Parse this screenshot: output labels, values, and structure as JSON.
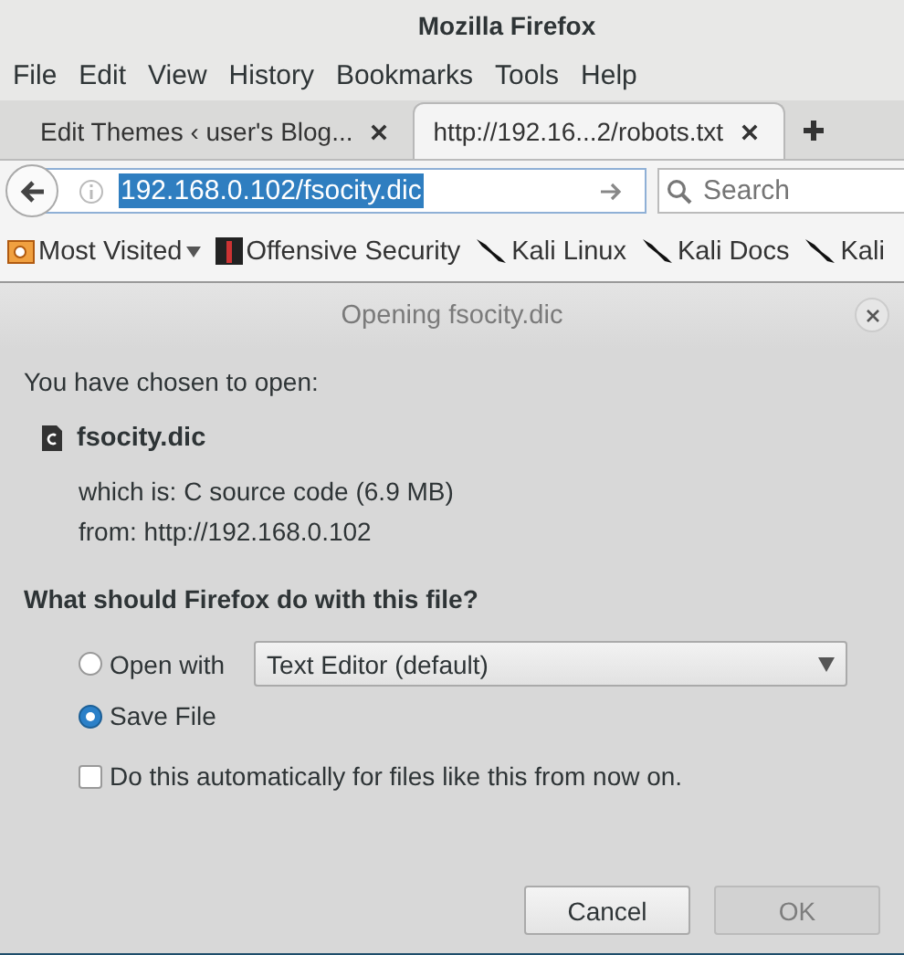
{
  "window": {
    "title": "Mozilla Firefox"
  },
  "menu": [
    "File",
    "Edit",
    "View",
    "History",
    "Bookmarks",
    "Tools",
    "Help"
  ],
  "tabs": [
    {
      "label": "Edit Themes ‹ user's Blog...",
      "selected": false
    },
    {
      "label": "http://192.16...2/robots.txt",
      "selected": true
    }
  ],
  "address_bar": {
    "value": "192.168.0.102/fsocity.dic",
    "selected": true
  },
  "search": {
    "placeholder": "Search"
  },
  "bookmarks": [
    {
      "label": "Most Visited",
      "kind": "folder"
    },
    {
      "label": "Offensive Security",
      "kind": "site"
    },
    {
      "label": "Kali Linux",
      "kind": "kali"
    },
    {
      "label": "Kali Docs",
      "kind": "kali"
    },
    {
      "label": "Kali",
      "kind": "kali"
    }
  ],
  "dialog": {
    "title": "Opening fsocity.dic",
    "intro": "You have chosen to open:",
    "file": {
      "name": "fsocity.dic",
      "type_line": "which is: C source code (6.9 MB)",
      "from_line": "from: http://192.168.0.102"
    },
    "question": "What should Firefox do with this file?",
    "options": [
      {
        "label": "Open with",
        "selected": false,
        "kind": "app-select",
        "app": "Text Editor (default)"
      },
      {
        "label": "Save File",
        "selected": true,
        "kind": "plain"
      }
    ],
    "remember": {
      "label": "Do this automatically for files like this from now on.",
      "checked": false
    },
    "buttons": [
      {
        "label": "Cancel",
        "disabled": false
      },
      {
        "label": "OK",
        "disabled": true
      }
    ]
  }
}
